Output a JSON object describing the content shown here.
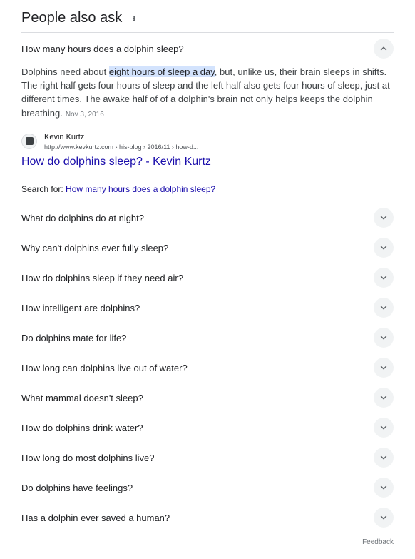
{
  "header": {
    "title": "People also ask",
    "more_icon": "more-vert-icon"
  },
  "expanded": {
    "question": "How many hours does a dolphin sleep?",
    "answer_before": "Dolphins need about ",
    "answer_highlight": "eight hours of sleep a day",
    "answer_after": ", but, unlike us, their brain sleeps in shifts. The right half gets four hours of sleep and the left half also gets four hours of sleep, just at different times. The awake half of of a dolphin's brain not only helps keeps the dolphin breathing.",
    "date": "Nov 3, 2016",
    "source_name": "Kevin Kurtz",
    "source_url": "http://www.kevkurtz.com › his-blog › 2016/11 › how-d...",
    "result_title": "How do dolphins sleep? - Kevin Kurtz",
    "search_for_label": "Search for: ",
    "search_for_query": "How many hours does a dolphin sleep?"
  },
  "questions": [
    "What do dolphins do at night?",
    "Why can't dolphins ever fully sleep?",
    "How do dolphins sleep if they need air?",
    "How intelligent are dolphins?",
    "Do dolphins mate for life?",
    "How long can dolphins live out of water?",
    "What mammal doesn't sleep?",
    "How do dolphins drink water?",
    "How long do most dolphins live?",
    "Do dolphins have feelings?",
    "Has a dolphin ever saved a human?"
  ],
  "feedback_label": "Feedback",
  "colors": {
    "link": "#1a0dab",
    "highlight": "#d3e3fd",
    "chevron_bg": "#f1f3f4"
  }
}
